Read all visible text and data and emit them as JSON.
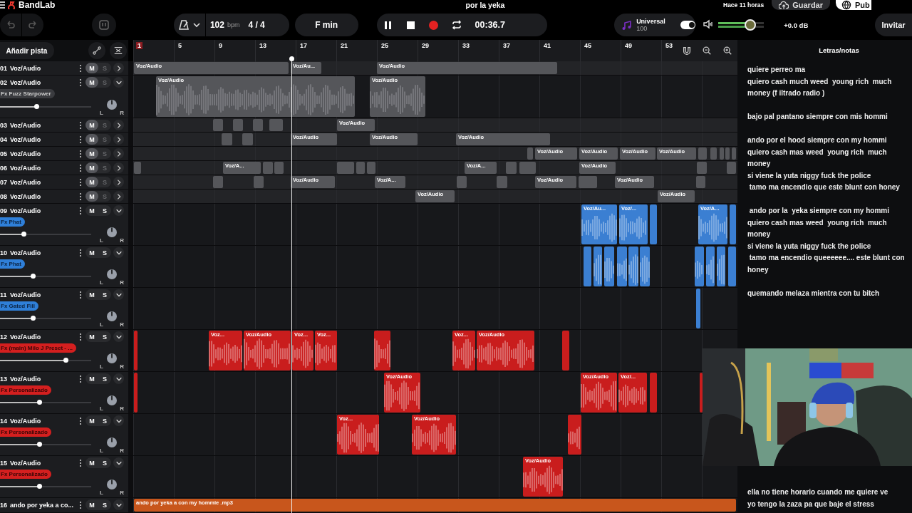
{
  "header": {
    "logo": "BandLab",
    "title": "por la yeka",
    "saved_time": "Hace 11 horas",
    "save_button": "Guardar",
    "publish_button": "Pub"
  },
  "toolbar": {
    "tempo": "102",
    "tempo_unit": "bpm",
    "time_signature": "4 / 4",
    "key": "F min",
    "playing": true,
    "time": "00:36.7",
    "preset": {
      "name": "Universal",
      "value": "100",
      "on": true
    },
    "master": {
      "level": 0.7,
      "reading": "+0.0 dB"
    },
    "invite_button": "Invitar"
  },
  "add_track_button": "Añadir pista",
  "ruler": {
    "bars": [
      "1",
      "5",
      "9",
      "13",
      "17",
      "21",
      "25",
      "29",
      "33",
      "37",
      "41",
      "45",
      "49",
      "53"
    ]
  },
  "tracks": [
    {
      "number": "01",
      "name": "Voz/Audio",
      "mute_button": "M",
      "solo_button": "S",
      "muted": true,
      "expanded": false,
      "color": "#55565a",
      "clips": [
        {
          "label": "Voz/Audio"
        },
        {
          "label": "Voz/Au..."
        },
        {
          "label": "Voz/Audio"
        }
      ]
    },
    {
      "number": "02",
      "name": "Voz/Audio",
      "mute_button": "M",
      "solo_button": "S",
      "muted": true,
      "expanded": true,
      "color": "#55565a",
      "fx": {
        "label": "Fx Fuzz Starpower",
        "color": "#3a3b3f"
      },
      "level": 0.4,
      "pan": {
        "left": "L",
        "right": "R"
      },
      "clips": [
        {
          "label": "Voz/Audio"
        },
        {
          "label": "Voz/Audio"
        }
      ]
    },
    {
      "number": "03",
      "name": "Voz/Audio",
      "mute_button": "M",
      "solo_button": "S",
      "muted": true,
      "expanded": false,
      "color": "#55565a",
      "clips": [
        {
          "label": "Voz/Audio"
        }
      ]
    },
    {
      "number": "04",
      "name": "Voz/Audio",
      "mute_button": "M",
      "solo_button": "S",
      "muted": true,
      "expanded": false,
      "color": "#55565a",
      "clips": [
        {
          "label": "Voz/Audio"
        },
        {
          "label": "Voz/Audio"
        },
        {
          "label": "Voz/Audio"
        }
      ]
    },
    {
      "number": "05",
      "name": "Voz/Audio",
      "mute_button": "M",
      "solo_button": "S",
      "muted": true,
      "expanded": false,
      "color": "#55565a",
      "clips": [
        {
          "label": "Voz/Audio"
        },
        {
          "label": "Voz/Audio"
        },
        {
          "label": "Voz/Audio"
        },
        {
          "label": "Voz/Audio"
        }
      ]
    },
    {
      "number": "06",
      "name": "Voz/Audio",
      "mute_button": "M",
      "solo_button": "S",
      "muted": true,
      "expanded": false,
      "color": "#55565a",
      "clips": [
        {
          "label": "Voz/A..."
        },
        {
          "label": "Voz/A..."
        },
        {
          "label": "Voz/Audio"
        }
      ]
    },
    {
      "number": "07",
      "name": "Voz/Audio",
      "mute_button": "M",
      "solo_button": "S",
      "muted": true,
      "expanded": false,
      "color": "#55565a",
      "clips": [
        {
          "label": "Voz/Audio"
        },
        {
          "label": "Voz/A..."
        },
        {
          "label": "Voz/Audio"
        },
        {
          "label": "Voz/Audio"
        }
      ]
    },
    {
      "number": "08",
      "name": "Voz/Audio",
      "mute_button": "M",
      "solo_button": "S",
      "muted": true,
      "expanded": false,
      "color": "#55565a",
      "clips": [
        {
          "label": "Voz/Audio"
        },
        {
          "label": "Voz/Audio"
        }
      ]
    },
    {
      "number": "09",
      "name": "Voz/Audio",
      "mute_button": "M",
      "solo_button": "S",
      "muted": false,
      "expanded": true,
      "color": "#3b7fd2",
      "fx": {
        "label": "Fx Phat",
        "color": "#2f7fd8"
      },
      "level": 0.26,
      "pan": {
        "left": "L",
        "right": "R"
      },
      "clips": [
        {
          "label": "Voz/Au..."
        },
        {
          "label": "Voz/..."
        },
        {
          "label": "Voz/A..."
        }
      ]
    },
    {
      "number": "10",
      "name": "Voz/Audio",
      "mute_button": "M",
      "solo_button": "S",
      "muted": false,
      "expanded": true,
      "color": "#3b7fd2",
      "fx": {
        "label": "Fx Phat",
        "color": "#2f7fd8"
      },
      "level": 0.36,
      "pan": {
        "left": "L",
        "right": "R"
      }
    },
    {
      "number": "11",
      "name": "Voz/Audio",
      "mute_button": "M",
      "solo_button": "S",
      "muted": false,
      "expanded": true,
      "color": "#3b7fd2",
      "fx": {
        "label": "Fx Gated Fill",
        "color": "#2f7fd8"
      },
      "level": 0.36,
      "pan": {
        "left": "L",
        "right": "R"
      }
    },
    {
      "number": "12",
      "name": "Voz/Audio",
      "mute_button": "M",
      "solo_button": "S",
      "muted": false,
      "expanded": true,
      "color": "#c91d1d",
      "fx": {
        "label": "Fx (main) Milo J Preset - ...",
        "color": "#d41f1f"
      },
      "level": 0.72,
      "pan": {
        "left": "L",
        "right": "R"
      },
      "clips": [
        {
          "label": "Voz..."
        },
        {
          "label": "Voz/Audio"
        },
        {
          "label": "Voz..."
        },
        {
          "label": "Voz..."
        },
        {
          "label": "Voz..."
        },
        {
          "label": "Voz/Audio"
        }
      ]
    },
    {
      "number": "13",
      "name": "Voz/Audio",
      "mute_button": "M",
      "solo_button": "S",
      "muted": false,
      "expanded": true,
      "color": "#c91d1d",
      "fx": {
        "label": "Fx Personalizado",
        "color": "#d41f1f"
      },
      "level": 0.43,
      "pan": {
        "left": "L",
        "right": "R"
      },
      "clips": [
        {
          "label": "Voz/Audio"
        },
        {
          "label": "Voz/Audio"
        },
        {
          "label": "Voz/..."
        }
      ]
    },
    {
      "number": "14",
      "name": "Voz/Audio",
      "mute_button": "M",
      "solo_button": "S",
      "muted": false,
      "expanded": true,
      "color": "#c91d1d",
      "fx": {
        "label": "Fx Personalizado",
        "color": "#d41f1f"
      },
      "level": 0.43,
      "pan": {
        "left": "L",
        "right": "R"
      },
      "clips": [
        {
          "label": "Voz..."
        },
        {
          "label": "Voz/Audio"
        }
      ]
    },
    {
      "number": "15",
      "name": "Voz/Audio",
      "mute_button": "M",
      "solo_button": "S",
      "muted": false,
      "expanded": true,
      "color": "#c91d1d",
      "fx": {
        "label": "Fx Personalizado",
        "color": "#d41f1f"
      },
      "level": 0.43,
      "pan": {
        "left": "L",
        "right": "R"
      },
      "clips": [
        {
          "label": "Voz/Audio"
        }
      ]
    },
    {
      "number": "16",
      "name": "ando por yeka a co...",
      "mute_button": "M",
      "solo_button": "S",
      "muted": false,
      "expanded": true,
      "color": "#c8561c",
      "clips": [
        {
          "label": "ando por yeka a con my hommie .mp3"
        }
      ]
    }
  ],
  "lyrics": {
    "title": "Letras/notas",
    "stanzas": [
      [
        "quiere perreo ma",
        "quiero cash much weed  young rich  much money (f iltrado radio )"
      ],
      [
        "bajo pal pantano siempre con mis hommi"
      ],
      [
        "ando por el hood siempre con my hommi",
        "quiero cash mas weed  young rich  much money",
        "si viene la yuta niggy fuck the police",
        " tamo ma encendio que este blunt con honey"
      ],
      [
        " ando por la  yeka siempre con my hommi",
        "quiero cash mas weed  young rich  much money",
        "si viene la yuta niggy fuck the police",
        " tamo ma encendio queeeeee.... este blunt con honey"
      ],
      [
        "quemando melaza mientra con tu bitch"
      ]
    ],
    "after_overlay": [
      [
        "ella no tiene horario cuando me quiere ve",
        "yo tengo la zaza pa que baje el stress"
      ]
    ]
  }
}
